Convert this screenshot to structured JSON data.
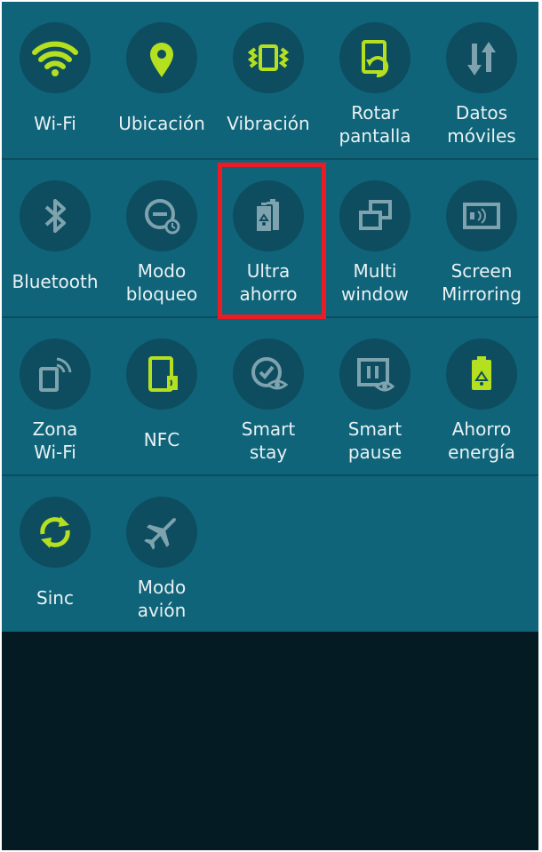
{
  "colors": {
    "panel": "#0f6479",
    "circle": "#0d4d5f",
    "icon_active": "#b4e01f",
    "icon_inactive": "#7ea3ae",
    "label": "#e9f1f3",
    "highlight": "#ed1c24",
    "screen_dark": "#041b23"
  },
  "quick_settings": {
    "rows": [
      [
        {
          "label_1": "Wi-Fi",
          "label_2": "",
          "icon": "wifi-icon",
          "active": true
        },
        {
          "label_1": "Ubicación",
          "label_2": "",
          "icon": "location-pin-icon",
          "active": true
        },
        {
          "label_1": "Vibración",
          "label_2": "",
          "icon": "vibrate-icon",
          "active": true
        },
        {
          "label_1": "Rotar",
          "label_2": "pantalla",
          "icon": "rotate-screen-icon",
          "active": true
        },
        {
          "label_1": "Datos",
          "label_2": "móviles",
          "icon": "mobile-data-icon",
          "active": false
        }
      ],
      [
        {
          "label_1": "Bluetooth",
          "label_2": "",
          "icon": "bluetooth-icon",
          "active": false
        },
        {
          "label_1": "Modo",
          "label_2": "bloqueo",
          "icon": "blocking-mode-icon",
          "active": false
        },
        {
          "label_1": "Ultra",
          "label_2": "ahorro",
          "icon": "ultra-power-saving-icon",
          "active": false
        },
        {
          "label_1": "Multi",
          "label_2": "window",
          "icon": "multi-window-icon",
          "active": false
        },
        {
          "label_1": "Screen",
          "label_2": "Mirroring",
          "icon": "screen-mirroring-icon",
          "active": false
        }
      ],
      [
        {
          "label_1": "Zona",
          "label_2": "Wi-Fi",
          "icon": "wifi-hotspot-icon",
          "active": false
        },
        {
          "label_1": "NFC",
          "label_2": "",
          "icon": "nfc-icon",
          "active": true
        },
        {
          "label_1": "Smart",
          "label_2": "stay",
          "icon": "smart-stay-icon",
          "active": false
        },
        {
          "label_1": "Smart",
          "label_2": "pause",
          "icon": "smart-pause-icon",
          "active": false
        },
        {
          "label_1": "Ahorro",
          "label_2": "energía",
          "icon": "power-saving-icon",
          "active": true
        }
      ],
      [
        {
          "label_1": "Sinc",
          "label_2": "",
          "icon": "sync-icon",
          "active": true
        },
        {
          "label_1": "Modo",
          "label_2": "avión",
          "icon": "airplane-mode-icon",
          "active": false
        }
      ]
    ]
  }
}
